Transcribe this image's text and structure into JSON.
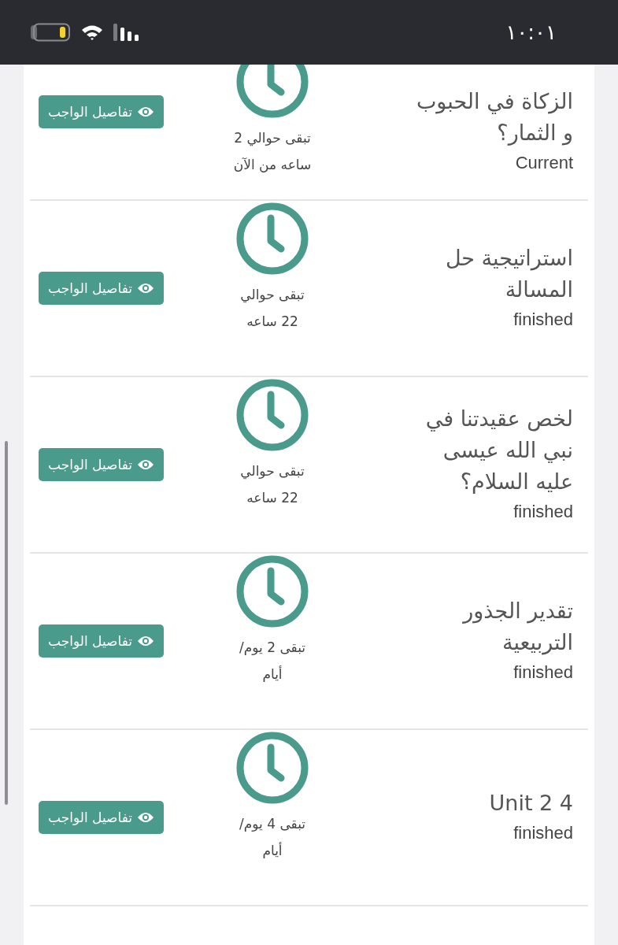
{
  "status_bar": {
    "time": "١٠:٠١"
  },
  "assignments": [
    {
      "title_lines": [
        "الزكاة في الحبوب",
        "و الثمار؟"
      ],
      "status": "Current",
      "remaining_lines": [
        "تبقى حوالي 2",
        "ساعه من الآن"
      ],
      "button": "تفاصيل الواجب"
    },
    {
      "title_lines": [
        "استراتيجية حل",
        "المسالة"
      ],
      "status": "finished",
      "remaining_lines": [
        "تبقى حوالي",
        "22 ساعه"
      ],
      "button": "تفاصيل الواجب"
    },
    {
      "title_lines": [
        "لخص عقيدتنا في",
        "نبي الله عيسى",
        "عليه السلام؟"
      ],
      "status": "finished",
      "remaining_lines": [
        "تبقى حوالي",
        "22 ساعه"
      ],
      "button": "تفاصيل الواجب"
    },
    {
      "title_lines": [
        "تقدير الجذور",
        "التربيعية"
      ],
      "status": "finished",
      "remaining_lines": [
        "تبقى 2 يوم/",
        "أيام"
      ],
      "button": "تفاصيل الواجب"
    },
    {
      "title_lines": [
        "Unit 2 4"
      ],
      "status": "finished",
      "remaining_lines": [
        "تبقى 4 يوم/",
        "أيام"
      ],
      "button": "تفاصيل الواجب"
    }
  ]
}
